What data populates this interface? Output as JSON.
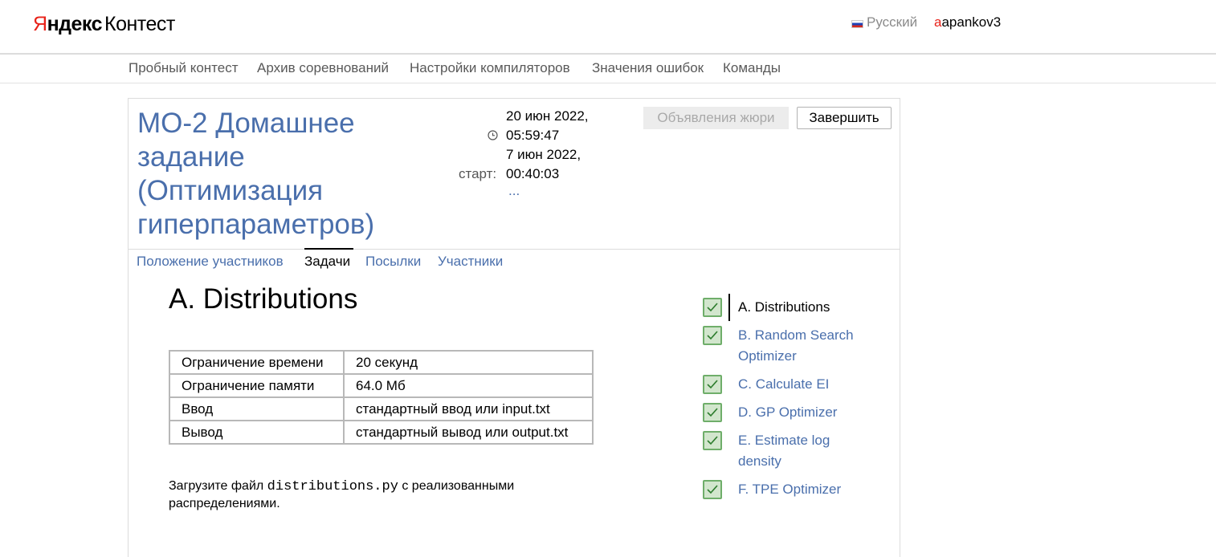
{
  "header": {
    "logo_ya_first": "Я",
    "logo_ya_rest": "ндекс",
    "logo_kontest": "Контест",
    "language": "Русский",
    "user_first": "a",
    "user_rest": "apankov3"
  },
  "topnav": [
    "Пробный контест",
    "Архив соревнований",
    "Настройки компиляторов",
    "Значения ошибок",
    "Команды"
  ],
  "contest": {
    "title": "МО-2 Домашнее задание (Оптимизация гиперпараметров)",
    "date_end_1": "20 июн 2022,",
    "date_end_2": "05:59:47",
    "date_start_1": "7 июн 2022,",
    "date_start_2": "00:40:03",
    "start_label": "старт:",
    "more": "...",
    "jury_button": "Объявления жюри",
    "finish_button": "Завершить"
  },
  "tabs": [
    "Положение участников",
    "Задачи",
    "Посылки",
    "Участники"
  ],
  "problem": {
    "title": "A. Distributions",
    "limits": [
      {
        "key": "Ограничение времени",
        "value": "20 секунд"
      },
      {
        "key": "Ограничение памяти",
        "value": "64.0 Мб"
      },
      {
        "key": "Ввод",
        "value": "стандартный ввод или input.txt"
      },
      {
        "key": "Вывод",
        "value": "стандартный вывод или output.txt"
      }
    ],
    "statement_before": "Загрузите файл ",
    "statement_code": "distributions.py",
    "statement_after": " с реализованными распределениями."
  },
  "problems": [
    {
      "label": "A. Distributions",
      "status": "accepted"
    },
    {
      "label": "B. Random Search Optimizer",
      "status": "accepted"
    },
    {
      "label": "C. Calculate EI",
      "status": "accepted"
    },
    {
      "label": "D. GP Optimizer",
      "status": "accepted"
    },
    {
      "label": "E. Estimate log density",
      "status": "accepted"
    },
    {
      "label": "F. TPE Optimizer",
      "status": "accepted"
    }
  ]
}
